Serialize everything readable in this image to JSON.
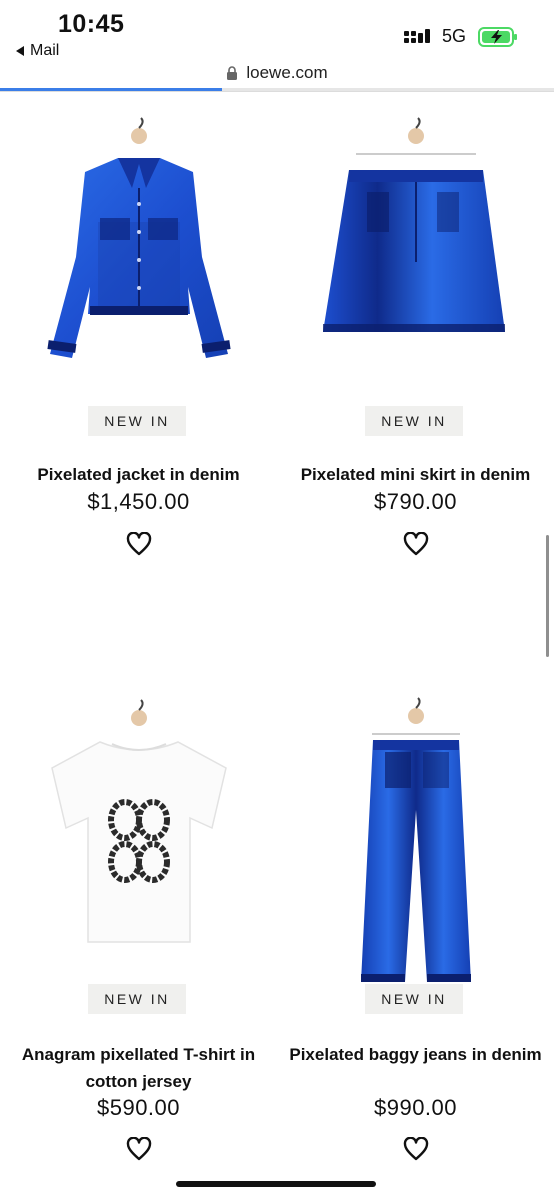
{
  "status": {
    "time": "10:45",
    "back_app": "Mail",
    "network": "5G"
  },
  "browser": {
    "url": "loewe.com",
    "load_progress": 0.4
  },
  "products": [
    {
      "badge": "NEW IN",
      "name": "Pixelated jacket in denim",
      "price": "$1,450.00",
      "image": "denim-jacket"
    },
    {
      "badge": "NEW IN",
      "name": "Pixelated mini skirt in denim",
      "price": "$790.00",
      "image": "denim-skirt"
    },
    {
      "badge": "NEW IN",
      "name": "Anagram pixellated T-shirt in cotton jersey",
      "price": "$590.00",
      "image": "white-tshirt"
    },
    {
      "badge": "NEW IN",
      "name": "Pixelated baggy jeans in denim",
      "price": "$990.00",
      "image": "denim-jeans"
    }
  ],
  "colors": {
    "denim": "#1f5fd6",
    "denim_dark": "#0b1f6e",
    "badge_bg": "#f0f0ee",
    "progress": "#3b7ee8",
    "battery": "#4cd964"
  }
}
